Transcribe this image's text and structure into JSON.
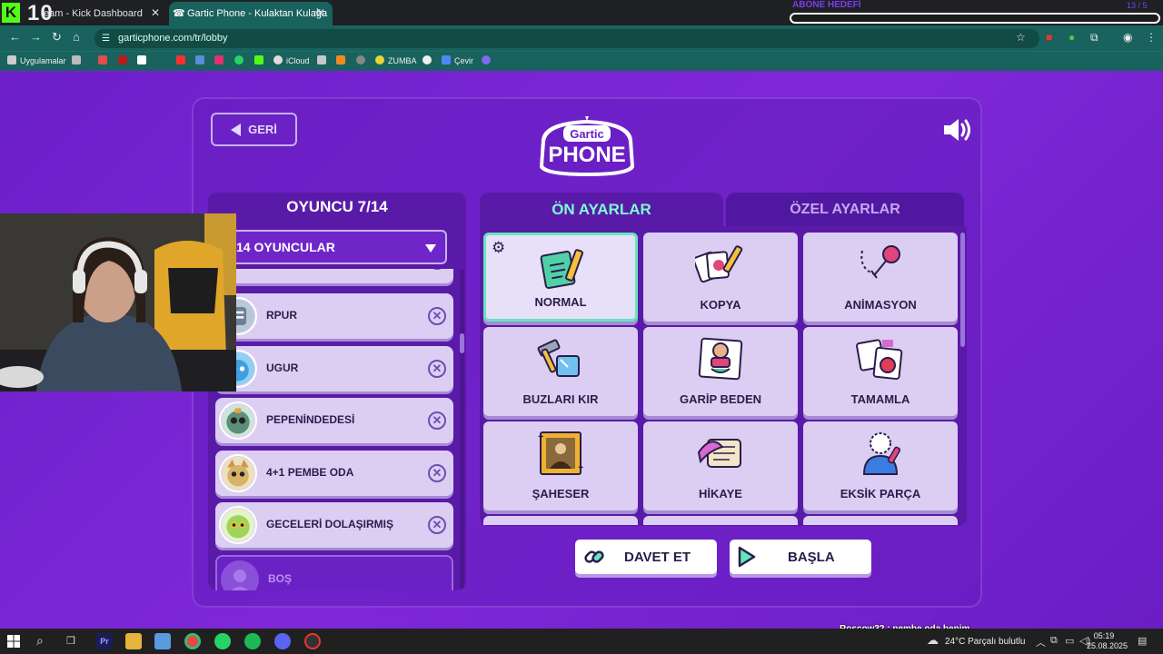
{
  "stream_overlay": {
    "counter": "10",
    "goal_label": "ABONE HEDEFİ",
    "goal_count": "13 / 5"
  },
  "browser": {
    "tabs": [
      {
        "label": "eam - Kick Dashboard",
        "active": false
      },
      {
        "label": "Gartic Phone - Kulaktan Kulağa",
        "active": true
      }
    ],
    "url": "garticphone.com/tr/lobby",
    "bookmarks": [
      {
        "label": "Uygulamalar",
        "color": "#cccccc"
      },
      {
        "label": "",
        "color": "#bbbbbb"
      },
      {
        "label": "",
        "color": "#e34d4d"
      },
      {
        "label": "",
        "color": "#b02020"
      },
      {
        "label": "",
        "color": "#ffffff"
      },
      {
        "label": "",
        "color": "#ff2f2f"
      },
      {
        "label": "",
        "color": "#5b8cd6"
      },
      {
        "label": "",
        "color": "#e1306c"
      },
      {
        "label": "",
        "color": "#25d366"
      },
      {
        "label": "",
        "color": "#53fc18"
      },
      {
        "label": "iCloud",
        "color": "#dddddd"
      },
      {
        "label": "",
        "color": "#c8c8c8"
      },
      {
        "label": "",
        "color": "#f08a24"
      },
      {
        "label": "",
        "color": "#888888"
      },
      {
        "label": "ZUMBA",
        "color": "#e9d33a"
      },
      {
        "label": "",
        "color": "#eeeeee"
      },
      {
        "label": "Çevir",
        "color": "#4a8af4"
      },
      {
        "label": "",
        "color": "#7b6cf0"
      }
    ]
  },
  "game": {
    "back_label": "GERİ",
    "logo_top": "Gartic",
    "logo_bottom": "PHONE",
    "players_title": "OYUNCU 7/14",
    "player_select": "14 OYUNCULAR",
    "players": [
      {
        "name": "RPUR",
        "avatar_color": "#b9c8d6",
        "empty": false
      },
      {
        "name": "UGUR",
        "avatar_color": "#5bb0e6",
        "empty": false
      },
      {
        "name": "PEPENİNDEDESİ",
        "avatar_color": "#5c8f7a",
        "empty": false
      },
      {
        "name": "4+1 PEMBE ODA",
        "avatar_color": "#d7b26a",
        "empty": false
      },
      {
        "name": "GECELERİ DOLAŞIRMIŞ",
        "avatar_color": "#9fd35a",
        "empty": false
      },
      {
        "name": "BOŞ",
        "avatar_color": "#8a50d8",
        "empty": true
      }
    ],
    "kick_symbol": "✕",
    "tab_presets": "ÖN AYARLAR",
    "tab_custom": "ÖZEL AYARLAR",
    "presets": [
      {
        "name": "NORMAL",
        "selected": true,
        "icon": "notebook-pencil-icon",
        "color": "#4fd1a8"
      },
      {
        "name": "KOPYA",
        "selected": false,
        "icon": "cards-pencil-icon",
        "color": "#e0457b"
      },
      {
        "name": "ANİMASYON",
        "selected": false,
        "icon": "animation-ball-icon",
        "color": "#e0457b"
      },
      {
        "name": "BUZLARI KIR",
        "selected": false,
        "icon": "hammer-ice-icon",
        "color": "#6fc2f0"
      },
      {
        "name": "GARİP BEDEN",
        "selected": false,
        "icon": "strange-body-icon",
        "color": "#4fd1a8"
      },
      {
        "name": "TAMAMLA",
        "selected": false,
        "icon": "puzzle-apple-icon",
        "color": "#e03d5b"
      },
      {
        "name": "ŞAHESER",
        "selected": false,
        "icon": "painting-frame-icon",
        "color": "#f0b030"
      },
      {
        "name": "HİKAYE",
        "selected": false,
        "icon": "scroll-feather-icon",
        "color": "#d66ad0"
      },
      {
        "name": "EKSİK PARÇA",
        "selected": false,
        "icon": "missing-piece-icon",
        "color": "#3b7ce0"
      }
    ],
    "invite_label": "DAVET ET",
    "start_label": "BAŞLA"
  },
  "chat": {
    "user": "Roscow32",
    "message": "pembe oda benim"
  },
  "taskbar": {
    "weather": "24°C  Parçalı bulutlu",
    "time": "05:19",
    "date": "25.08.2025"
  }
}
